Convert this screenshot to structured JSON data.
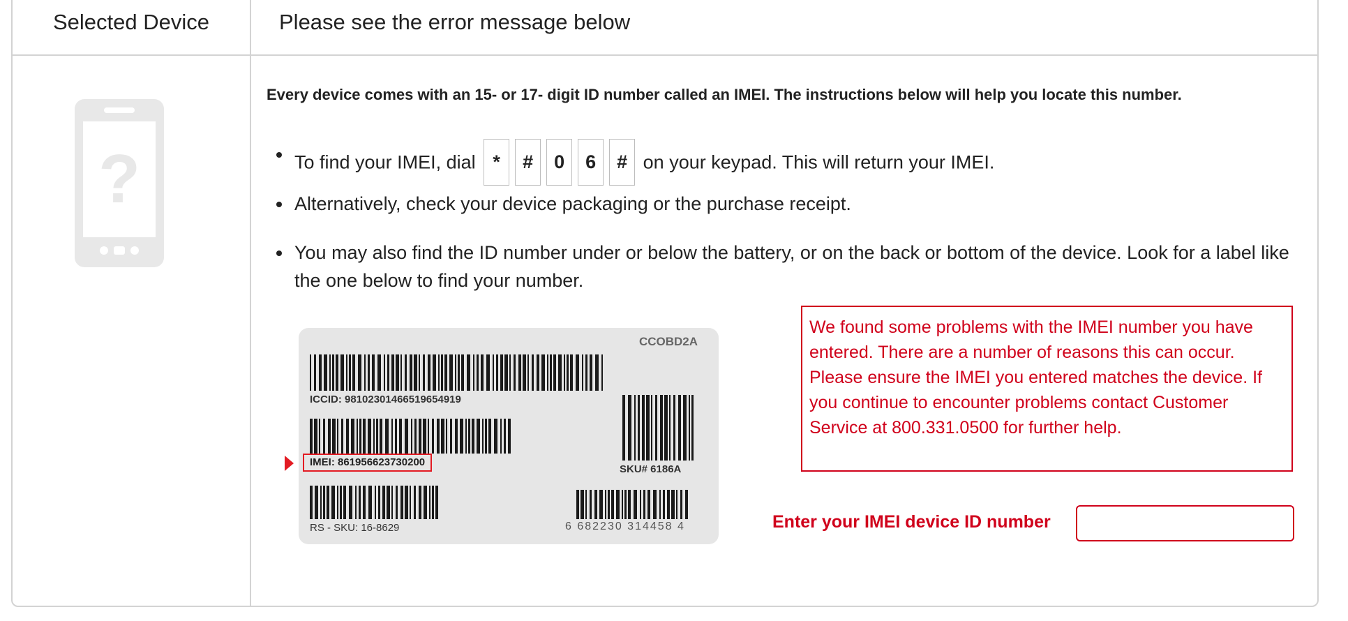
{
  "table": {
    "left_header": "Selected Device",
    "right_header": "Please see the error message below"
  },
  "device": {
    "placeholder_icon": "unknown-phone-icon",
    "question_mark": "?"
  },
  "instructions": {
    "intro": "Every device comes with an 15- or 17- digit ID number called an IMEI. The instructions below will help you locate this number.",
    "bullet_1_before": "To find your IMEI, dial",
    "dial_keys": [
      "*",
      "#",
      "0",
      "6",
      "#"
    ],
    "bullet_1_after": "on your keypad. This will return your IMEI.",
    "bullet_2": "Alternatively, check your device packaging or the purchase receipt.",
    "bullet_3": "You may also find the ID number under or below the battery, or on the back or bottom of the device. Look for a label like the one below to find your number."
  },
  "sample_label": {
    "code": "CCOBD2A",
    "iccid": "ICCID: 98102301466519654919",
    "imei": "IMEI: 861956623730200",
    "sku": "SKU# 6186A",
    "rs_sku": "RS - SKU: 16-8629",
    "upc": "6 682230 314458 4"
  },
  "error": {
    "message": "We found some problems with the IMEI number you have entered. There are a number of reasons this can occur. Please ensure the IMEI you entered matches the device. If you continue to encounter problems contact Customer Service at 800.331.0500 for further help.",
    "color": "#d0021b"
  },
  "imei_field": {
    "label": "Enter your IMEI device ID number",
    "value": "",
    "placeholder": ""
  }
}
